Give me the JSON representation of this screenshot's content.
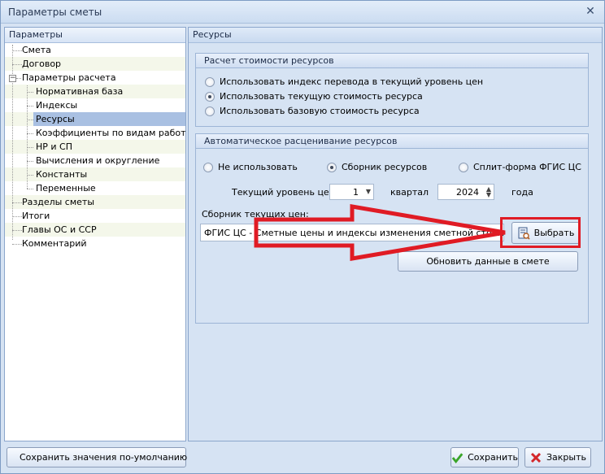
{
  "window": {
    "title": "Параметры сметы"
  },
  "left_panel": {
    "header": "Параметры",
    "tree": [
      {
        "label": "Смета"
      },
      {
        "label": "Договор"
      },
      {
        "label": "Параметры расчета"
      },
      {
        "label": "Нормативная база"
      },
      {
        "label": "Индексы"
      },
      {
        "label": "Ресурсы"
      },
      {
        "label": "Коэффициенты по видам работ"
      },
      {
        "label": "НР и СП"
      },
      {
        "label": "Вычисления и округление"
      },
      {
        "label": "Константы"
      },
      {
        "label": "Переменные"
      },
      {
        "label": "Разделы сметы"
      },
      {
        "label": "Итоги"
      },
      {
        "label": "Главы ОС и ССР"
      },
      {
        "label": "Комментарий"
      }
    ],
    "selected": "Ресурсы"
  },
  "right_panel": {
    "header": "Ресурсы",
    "cost_group": {
      "title": "Расчет стоимости ресурсов",
      "options": [
        "Использовать индекс перевода в текущий уровень цен",
        "Использовать текущую стоимость ресурса",
        "Использовать базовую стоимость ресурса"
      ],
      "selected_index": 1
    },
    "auto_group": {
      "title": "Автоматическое расценивание ресурсов",
      "options": [
        "Не использовать",
        "Сборник ресурсов",
        "Сплит-форма ФГИС ЦС"
      ],
      "selected_index": 1,
      "price_level_label": "Текущий уровень цен",
      "quarter_value": "1",
      "quarter_label": "квартал",
      "year_value": "2024",
      "year_label": "года",
      "collection_label": "Сборник  текущих цен:",
      "collection_value": "ФГИС ЦС - Сметные цены и индексы изменения сметной стоимости ст",
      "choose_button": "Выбрать",
      "update_button": "Обновить данные в смете"
    }
  },
  "footer": {
    "save_default_button": "Сохранить значения по-умолчанию",
    "save_button": "Сохранить",
    "close_button": "Закрыть"
  },
  "colors": {
    "highlight": "#e01b24",
    "selection": "#a9c0e2"
  }
}
